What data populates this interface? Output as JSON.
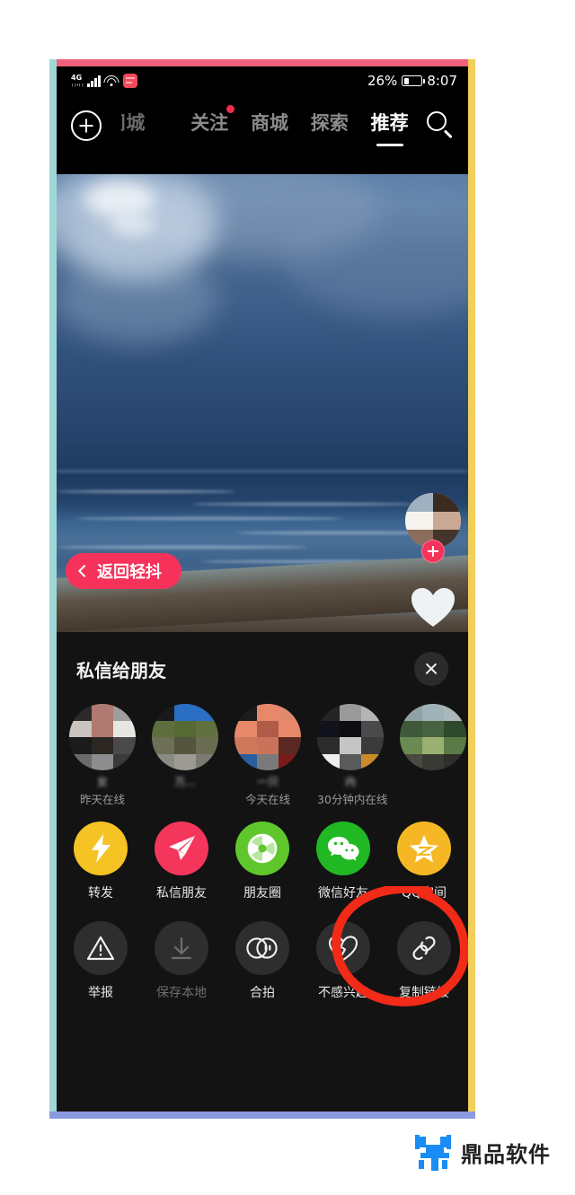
{
  "status_bar": {
    "network": "4G",
    "battery_percent": "26%",
    "time": "8:07",
    "icons": [
      "signal-icon",
      "wifi-icon",
      "app-icon",
      "battery-icon"
    ]
  },
  "top_nav": {
    "add_icon": "plus-circle-icon",
    "search_icon": "search-icon",
    "tabs": [
      {
        "label": "司城",
        "active": false,
        "badge": false
      },
      {
        "label": "关注",
        "active": false,
        "badge": true
      },
      {
        "label": "商城",
        "active": false,
        "badge": false
      },
      {
        "label": "探索",
        "active": false,
        "badge": false
      },
      {
        "label": "推荐",
        "active": true,
        "badge": false
      }
    ]
  },
  "video": {
    "back_button": {
      "label": "返回轻抖",
      "icon": "chevron-left-icon"
    },
    "creator": {
      "follow_icon": "plus-icon",
      "like_icon": "heart-icon"
    }
  },
  "share_sheet": {
    "title": "私信给朋友",
    "close_icon": "close-icon",
    "friends": [
      {
        "name": "女",
        "status": "昨天在线"
      },
      {
        "name": "万...",
        "status": ""
      },
      {
        "name": "一只",
        "status": "今天在线"
      },
      {
        "name": "内",
        "status": "30分钟内在线"
      },
      {
        "name": "",
        "status": ""
      }
    ],
    "share_row": [
      {
        "label": "转发",
        "icon": "lightning-icon",
        "color": "#f5c324",
        "disabled": false
      },
      {
        "label": "私信朋友",
        "icon": "paper-plane-icon",
        "color": "#f4365c",
        "disabled": false
      },
      {
        "label": "朋友圈",
        "icon": "aperture-icon",
        "color": "#5fc72b",
        "disabled": false
      },
      {
        "label": "微信好友",
        "icon": "wechat-icon",
        "color": "#20b823",
        "disabled": false
      },
      {
        "label": "QQ空间",
        "icon": "qzone-star-icon",
        "color": "#f5b824",
        "disabled": false
      }
    ],
    "action_row": [
      {
        "label": "举报",
        "icon": "warning-triangle-icon",
        "disabled": false,
        "highlighted": false
      },
      {
        "label": "保存本地",
        "icon": "download-icon",
        "disabled": true,
        "highlighted": false
      },
      {
        "label": "合拍",
        "icon": "duet-icon",
        "disabled": false,
        "highlighted": false
      },
      {
        "label": "不感兴趣",
        "icon": "broken-heart-icon",
        "disabled": false,
        "highlighted": false
      },
      {
        "label": "复制链接",
        "icon": "link-icon",
        "disabled": false,
        "highlighted": true
      }
    ]
  },
  "annotation": {
    "shape": "hand-drawn-circle",
    "color": "#f22a18",
    "target": "复制链接"
  },
  "watermark": {
    "text": "鼎品软件",
    "logo_color": "#1a8cf5"
  },
  "frame_colors": {
    "top": "#f2607c",
    "left": "#9fd8d6",
    "right": "#f2cf5a",
    "bottom": "#8b9ae0"
  }
}
